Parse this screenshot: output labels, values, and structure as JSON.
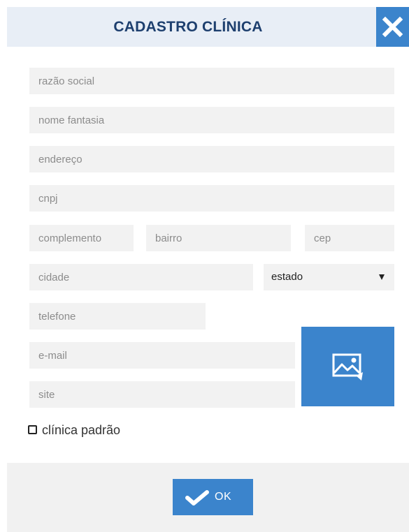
{
  "header": {
    "title": "CADASTRO CLÍNICA",
    "close_icon": "close-icon"
  },
  "form": {
    "razao_social": {
      "placeholder": "razão social",
      "value": ""
    },
    "nome_fantasia": {
      "placeholder": "nome fantasia",
      "value": ""
    },
    "endereco": {
      "placeholder": "endereço",
      "value": ""
    },
    "cnpj": {
      "placeholder": "cnpj",
      "value": ""
    },
    "complemento": {
      "placeholder": "complemento",
      "value": ""
    },
    "bairro": {
      "placeholder": "bairro",
      "value": ""
    },
    "cep": {
      "placeholder": "cep",
      "value": ""
    },
    "cidade": {
      "placeholder": "cidade",
      "value": ""
    },
    "estado": {
      "selected": "estado"
    },
    "telefone": {
      "placeholder": "telefone",
      "value": ""
    },
    "email": {
      "placeholder": "e-mail",
      "value": ""
    },
    "site": {
      "placeholder": "site",
      "value": ""
    },
    "image_upload_icon": "image-icon"
  },
  "default_clinic": {
    "label": "clínica padrão",
    "checked": false
  },
  "footer": {
    "ok_label": "OK",
    "ok_icon": "checkmark-icon"
  },
  "colors": {
    "accent": "#3b84cc",
    "header_bg": "#e8eef6",
    "title": "#1d3f6e",
    "field_bg": "#f2f2f2",
    "footer_bg": "#f1f1f1"
  }
}
